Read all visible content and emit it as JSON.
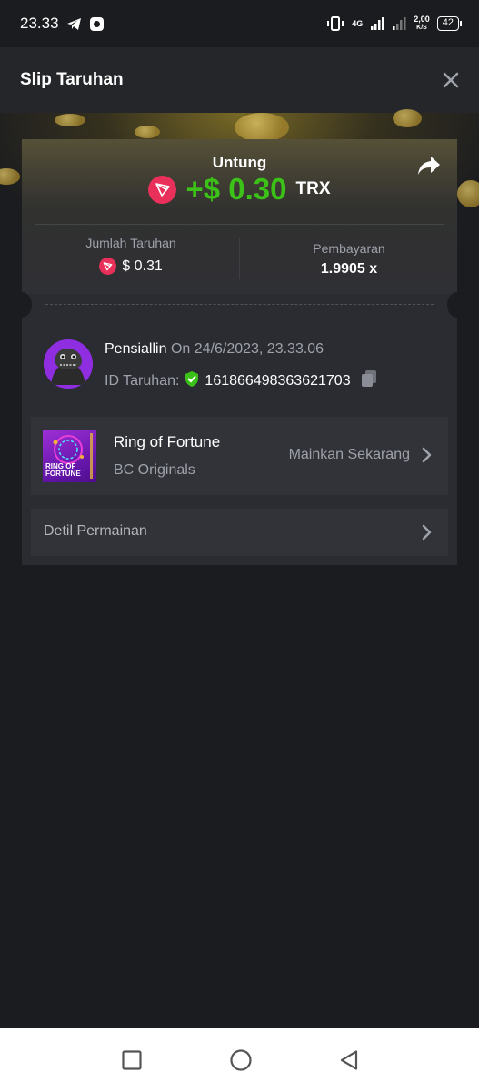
{
  "status_bar": {
    "time": "23.33",
    "network": "4G",
    "speed_value": "2,00",
    "speed_unit": "K/S",
    "battery": "42"
  },
  "header": {
    "title": "Slip Taruhan",
    "close_icon": "close-icon"
  },
  "profit": {
    "label": "Untung",
    "amount": "+$ 0.30",
    "currency": "TRX",
    "amount_color": "#3bc117"
  },
  "stats": {
    "bet_label": "Jumlah Taruhan",
    "bet_value": "$ 0.31",
    "payout_label": "Pembayaran",
    "payout_value": "1.9905 x"
  },
  "user": {
    "name": "Pensiallin",
    "date": "On 24/6/2023, 23.33.06",
    "bet_id_label": "ID Taruhan:",
    "bet_id": "161866498363621703"
  },
  "game": {
    "name": "Ring of Fortune",
    "provider": "BC Originals",
    "play_label": "Mainkan Sekarang",
    "thumb_text": "RING OF FORTUNE"
  },
  "details": {
    "label": "Detil Permainan"
  },
  "colors": {
    "background": "#1b1c1f",
    "card": "#2b2c31",
    "accent_green": "#3bc117",
    "trx_red": "#e8305a"
  }
}
